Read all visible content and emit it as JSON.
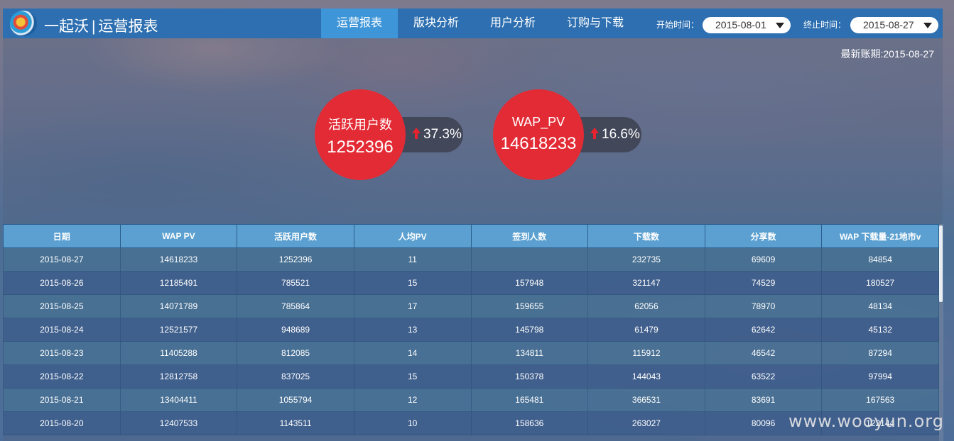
{
  "header": {
    "brand": "一起沃",
    "separator": "|",
    "title": "运营报表",
    "nav": [
      "运营报表",
      "版块分析",
      "用户分析",
      "订购与下载"
    ],
    "active_nav": 0,
    "start_label": "开始时间：",
    "start_value": "2015-08-01",
    "end_label": "终止时间：",
    "end_value": "2015-08-27"
  },
  "latest": "最新账期:2015-08-27",
  "kpis": [
    {
      "label": "活跃用户数",
      "value": "1252396",
      "change": "37.3%"
    },
    {
      "label": "WAP_PV",
      "value": "14618233",
      "change": "16.6%"
    }
  ],
  "table": {
    "headers": [
      "日期",
      "WAP PV",
      "活跃用户数",
      "人均PV",
      "签到人数",
      "下载数",
      "分享数",
      "WAP 下载量-21地市v"
    ],
    "rows": [
      [
        "2015-08-27",
        "14618233",
        "1252396",
        "11",
        "",
        "232735",
        "69609",
        "84854"
      ],
      [
        "2015-08-26",
        "12185491",
        "785521",
        "15",
        "157948",
        "321147",
        "74529",
        "180527"
      ],
      [
        "2015-08-25",
        "14071789",
        "785864",
        "17",
        "159655",
        "62056",
        "78970",
        "48134"
      ],
      [
        "2015-08-24",
        "12521577",
        "948689",
        "13",
        "145798",
        "61479",
        "62642",
        "45132"
      ],
      [
        "2015-08-23",
        "11405288",
        "812085",
        "14",
        "134811",
        "115912",
        "46542",
        "87294"
      ],
      [
        "2015-08-22",
        "12812758",
        "837025",
        "15",
        "150378",
        "144043",
        "63522",
        "97994"
      ],
      [
        "2015-08-21",
        "13404411",
        "1055794",
        "12",
        "165481",
        "366531",
        "83691",
        "167563"
      ],
      [
        "2015-08-20",
        "12407533",
        "1143511",
        "10",
        "158636",
        "263027",
        "80096",
        "122144"
      ]
    ]
  },
  "watermark": "www.wooyun.org",
  "colors": {
    "topbar": "#2d6fb0",
    "nav_active": "#3e95d8",
    "kpi_circle": "#e32b35",
    "up_arrow": "#e8232e",
    "table_header": "#5ba0d0"
  }
}
